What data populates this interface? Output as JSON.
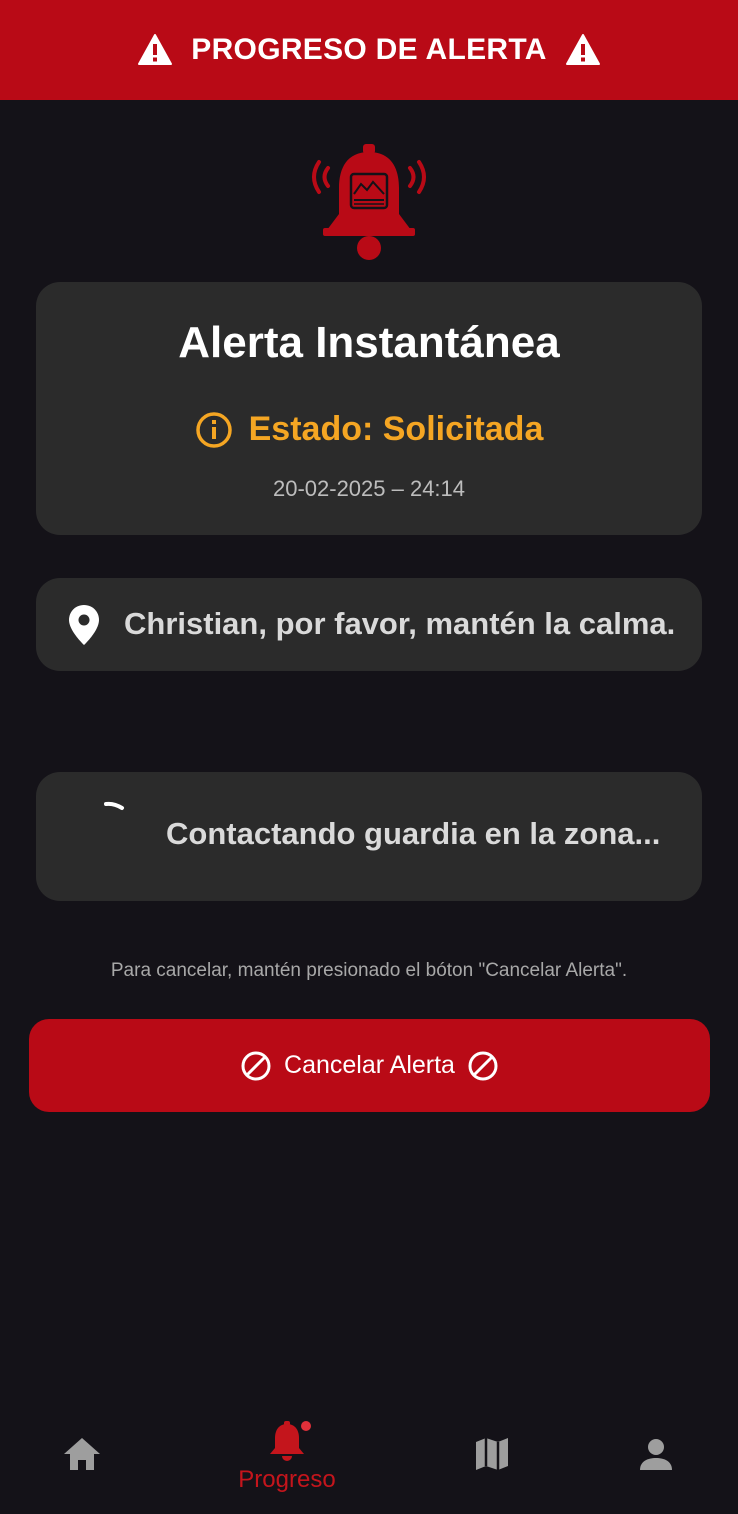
{
  "header": {
    "title": "PROGRESO DE ALERTA",
    "left_icon": "warning-icon",
    "right_icon": "warning-icon"
  },
  "hero_icon": "alarm-bell-icon",
  "alert_card": {
    "title": "Alerta Instantánea",
    "status_icon": "info-icon",
    "status_text": "Estado: Solicitada",
    "datetime": "20-02-2025 – 24:14"
  },
  "message_card": {
    "icon": "location-pin-icon",
    "text": "Christian, por favor, mantén la calma."
  },
  "contact_card": {
    "icon": "loading-spinner-icon",
    "text": "Contactando guardia en la zona..."
  },
  "hint": "Para cancelar, mantén presionado el bóton \"Cancelar Alerta\".",
  "cancel_button": {
    "label": "Cancelar Alerta",
    "icon": "ban-icon"
  },
  "bottom_nav": {
    "items": [
      {
        "icon": "home-icon",
        "label": ""
      },
      {
        "icon": "bell-icon",
        "label": "Progreso",
        "active": true
      },
      {
        "icon": "map-icon",
        "label": ""
      },
      {
        "icon": "person-icon",
        "label": ""
      }
    ]
  },
  "colors": {
    "brand_red": "#B90A16",
    "background": "#141218",
    "card": "#2B2B2B",
    "status_orange": "#F5A623",
    "nav_inactive": "#9E9E9E"
  }
}
